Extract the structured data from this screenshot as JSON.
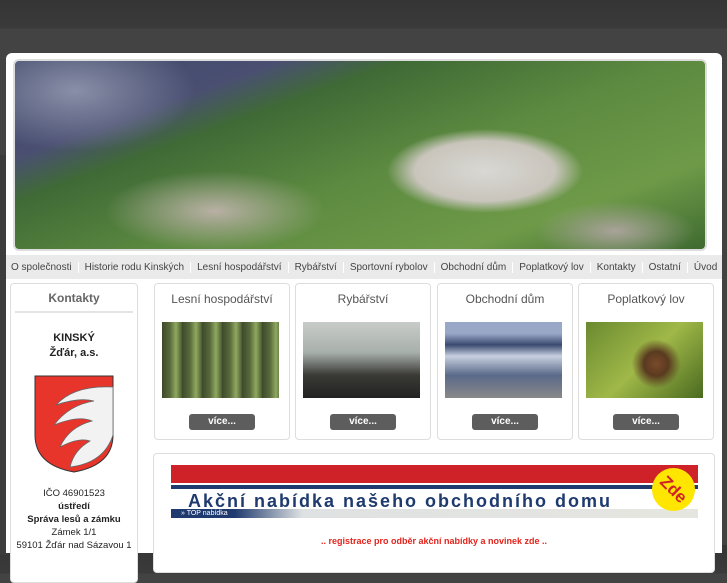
{
  "nav": [
    "O společnosti",
    "Historie rodu Kinských",
    "Lesní hospodářství",
    "Rybářství",
    "Sportovní rybolov",
    "Obchodní dům",
    "Poplatkový lov",
    "Kontakty",
    "Ostatní",
    "Úvod"
  ],
  "contacts": {
    "title": "Kontakty",
    "company_line1": "KINSKÝ",
    "company_line2": "Žďár, a.s.",
    "ico": "IČO 46901523",
    "hq": "ústředí",
    "org": "Správa lesů a zámku",
    "street": "Zámek 1/1",
    "city": "59101 Žďár nad Sázavou 1"
  },
  "cards": [
    {
      "title": "Lesní hospodářství",
      "more": "více..."
    },
    {
      "title": "Rybářství",
      "more": "více..."
    },
    {
      "title": "Obchodní dům",
      "more": "více..."
    },
    {
      "title": "Poplatkový lov",
      "more": "více..."
    }
  ],
  "promo": {
    "title": "Akční nabídka našeho obchodního domu",
    "top_label": "» TOP nabídka",
    "badge": "Zde",
    "register": ".. registrace pro odběr akční nabídky a novinek zde .."
  },
  "colors": {
    "accent_red": "#cf2228",
    "navy": "#1e3a6e",
    "button": "#5d5d5d"
  }
}
